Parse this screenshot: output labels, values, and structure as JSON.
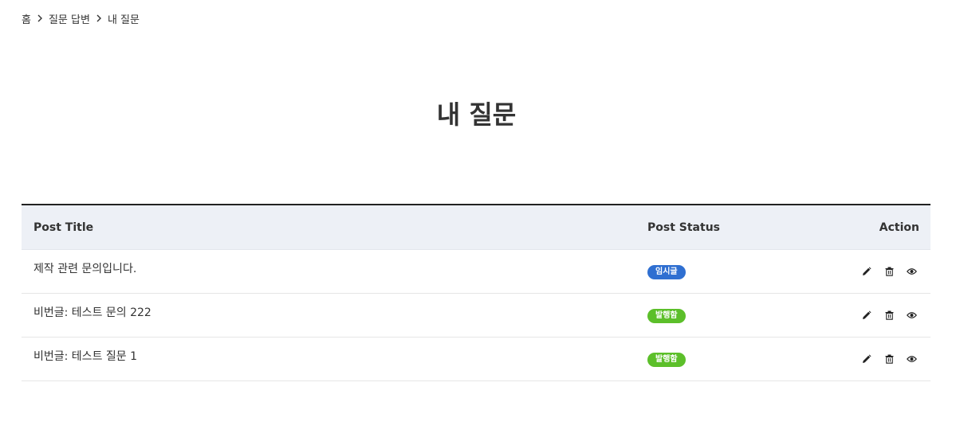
{
  "breadcrumb": {
    "items": [
      "홈",
      "질문 답변",
      "내 질문"
    ]
  },
  "page": {
    "title": "내 질문"
  },
  "table": {
    "headers": {
      "title": "Post Title",
      "status": "Post Status",
      "action": "Action"
    },
    "rows": [
      {
        "title": "제작 관련 문의입니다.",
        "status": "임시글",
        "status_color": "#2f6fd1"
      },
      {
        "title": "비번글: 테스트 문의 222",
        "status": "발행함",
        "status_color": "#5cbf2a"
      },
      {
        "title": "비번글: 테스트 질문 1",
        "status": "발행함",
        "status_color": "#5cbf2a"
      }
    ],
    "actions": [
      "pencil-icon",
      "trash-icon",
      "eye-icon"
    ]
  },
  "colors": {
    "header_bg": "#edf0f6",
    "draft": "#2f6fd1",
    "published": "#5cbf2a"
  }
}
